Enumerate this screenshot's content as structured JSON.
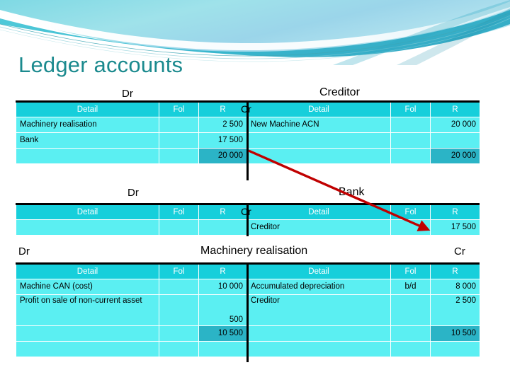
{
  "slide": {
    "title": "Ledger accounts",
    "title_color": "#1B8A8E",
    "theme_accent": "#16CFDB",
    "arrow_color": "#C00000"
  },
  "columns": {
    "detail": "Detail",
    "fol": "Fol",
    "amount": "R"
  },
  "labels": {
    "dr": "Dr",
    "cr": "Cr"
  },
  "accounts": [
    {
      "name": "Creditor",
      "dr_label": "Dr",
      "cr_label": "Cr",
      "rows": [
        {
          "dr_detail": "Machinery realisation",
          "dr_fol": "",
          "dr_amount": "2 500",
          "cr_detail": "New Machine ACN",
          "cr_fol": "",
          "cr_amount": "20 000",
          "total": false
        },
        {
          "dr_detail": "Bank",
          "dr_fol": "",
          "dr_amount": "17 500",
          "cr_detail": "",
          "cr_fol": "",
          "cr_amount": "",
          "total": false
        },
        {
          "dr_detail": "",
          "dr_fol": "",
          "dr_amount": "20 000",
          "cr_detail": "",
          "cr_fol": "",
          "cr_amount": "20 000",
          "total": true
        }
      ]
    },
    {
      "name": "Bank",
      "dr_label": "Dr",
      "cr_label": "Cr",
      "rows": [
        {
          "dr_detail": "",
          "dr_fol": "",
          "dr_amount": "",
          "cr_detail": "Creditor",
          "cr_fol": "",
          "cr_amount": "17 500",
          "total": false
        }
      ]
    },
    {
      "name": "Machinery realisation",
      "dr_label": "Dr",
      "cr_label": "Cr",
      "rows": [
        {
          "dr_detail": "Machine CAN (cost)",
          "dr_fol": "",
          "dr_amount": "10 000",
          "cr_detail": "Accumulated depreciation",
          "cr_fol": "b/d",
          "cr_amount": "8 000",
          "total": false
        },
        {
          "dr_detail": "Profit on sale of non-current asset",
          "dr_fol": "",
          "dr_amount": "500",
          "cr_detail": "Creditor",
          "cr_fol": "",
          "cr_amount": "2 500",
          "total": false
        },
        {
          "dr_detail": "",
          "dr_fol": "",
          "dr_amount": "10 500",
          "cr_detail": "",
          "cr_fol": "",
          "cr_amount": "10 500",
          "total": true
        },
        {
          "dr_detail": "",
          "dr_fol": "",
          "dr_amount": "",
          "cr_detail": "",
          "cr_fol": "",
          "cr_amount": "",
          "total": false
        }
      ]
    }
  ]
}
